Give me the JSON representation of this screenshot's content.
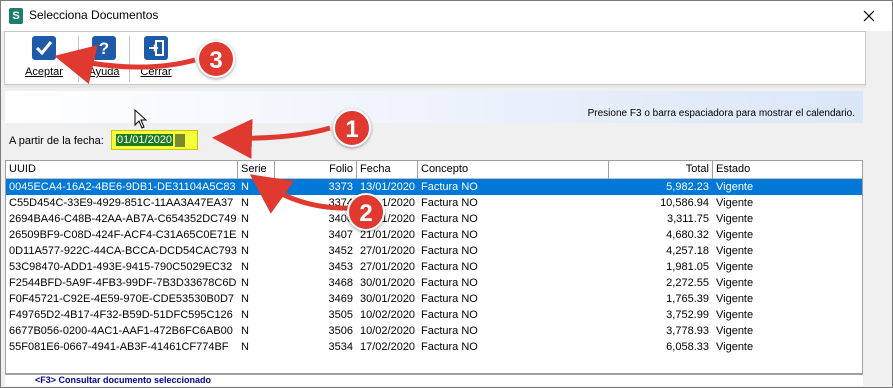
{
  "window": {
    "title": "Selecciona Documentos",
    "close_glyph": "✕"
  },
  "toolbar": {
    "accept_label": "Aceptar",
    "help_label": "Ayuda",
    "close_label": "Cerrar"
  },
  "info": {
    "hint": "Presione F3 o barra espaciadora para mostrar el calendario."
  },
  "filter": {
    "date_label": "A partir de la fecha:",
    "date_value": "01/01/2020"
  },
  "grid": {
    "columns": [
      "UUID",
      "Serie",
      "Folio",
      "Fecha",
      "Concepto",
      "Total",
      "Estado"
    ],
    "rows": [
      {
        "uuid": "0045ECA4-16A2-4BE6-9DB1-DE31104A5C83",
        "serie": "N",
        "folio": "3373",
        "fecha": "13/01/2020",
        "concepto": "Factura NO",
        "total": "5,982.23",
        "estado": "Vigente"
      },
      {
        "uuid": "C55D454C-33E9-4929-851C-11AA3A47EA37",
        "serie": "N",
        "folio": "3374",
        "fecha": "13/01/2020",
        "concepto": "Factura NO",
        "total": "10,586.94",
        "estado": "Vigente"
      },
      {
        "uuid": "2694BA46-C48B-42AA-AB7A-C654352DC749",
        "serie": "N",
        "folio": "3406",
        "fecha": "20/01/2020",
        "concepto": "Factura NO",
        "total": "3,311.75",
        "estado": "Vigente"
      },
      {
        "uuid": "26509BF9-C08D-424F-ACF4-C31A65C0E71E",
        "serie": "N",
        "folio": "3407",
        "fecha": "21/01/2020",
        "concepto": "Factura NO",
        "total": "4,680.32",
        "estado": "Vigente"
      },
      {
        "uuid": "0D11A577-922C-44CA-BCCA-DCD54CAC7937",
        "serie": "N",
        "folio": "3452",
        "fecha": "27/01/2020",
        "concepto": "Factura NO",
        "total": "4,257.18",
        "estado": "Vigente"
      },
      {
        "uuid": "53C98470-ADD1-493E-9415-790C5029EC32",
        "serie": "N",
        "folio": "3453",
        "fecha": "27/01/2020",
        "concepto": "Factura NO",
        "total": "1,981.05",
        "estado": "Vigente"
      },
      {
        "uuid": "F2544BFD-5A9F-4FB3-99DF-7B3D33678C6D",
        "serie": "N",
        "folio": "3468",
        "fecha": "30/01/2020",
        "concepto": "Factura NO",
        "total": "2,272.55",
        "estado": "Vigente"
      },
      {
        "uuid": "F0F45721-C92E-4E59-970E-CDE53530B0D7",
        "serie": "N",
        "folio": "3469",
        "fecha": "30/01/2020",
        "concepto": "Factura NO",
        "total": "1,765.39",
        "estado": "Vigente"
      },
      {
        "uuid": "F49765D2-4B17-4F32-B59D-51DFC595C126",
        "serie": "N",
        "folio": "3505",
        "fecha": "10/02/2020",
        "concepto": "Factura NO",
        "total": "3,752.99",
        "estado": "Vigente"
      },
      {
        "uuid": "6677B056-0200-4AC1-AAF1-472B6FC6AB00",
        "serie": "N",
        "folio": "3506",
        "fecha": "10/02/2020",
        "concepto": "Factura NO",
        "total": "3,778.93",
        "estado": "Vigente"
      },
      {
        "uuid": "55F081E6-0667-4941-AB3F-41461CF774BF",
        "serie": "N",
        "folio": "3534",
        "fecha": "17/02/2020",
        "concepto": "Factura NO",
        "total": "6,058.33",
        "estado": "Vigente"
      }
    ]
  },
  "status": {
    "text": "<F3> Consultar documento seleccionado"
  },
  "annotations": [
    "1",
    "2",
    "3"
  ],
  "colors": {
    "selection": "#0078d7",
    "date_highlight": "#f4ff3a",
    "annotation": "#e03a30"
  }
}
